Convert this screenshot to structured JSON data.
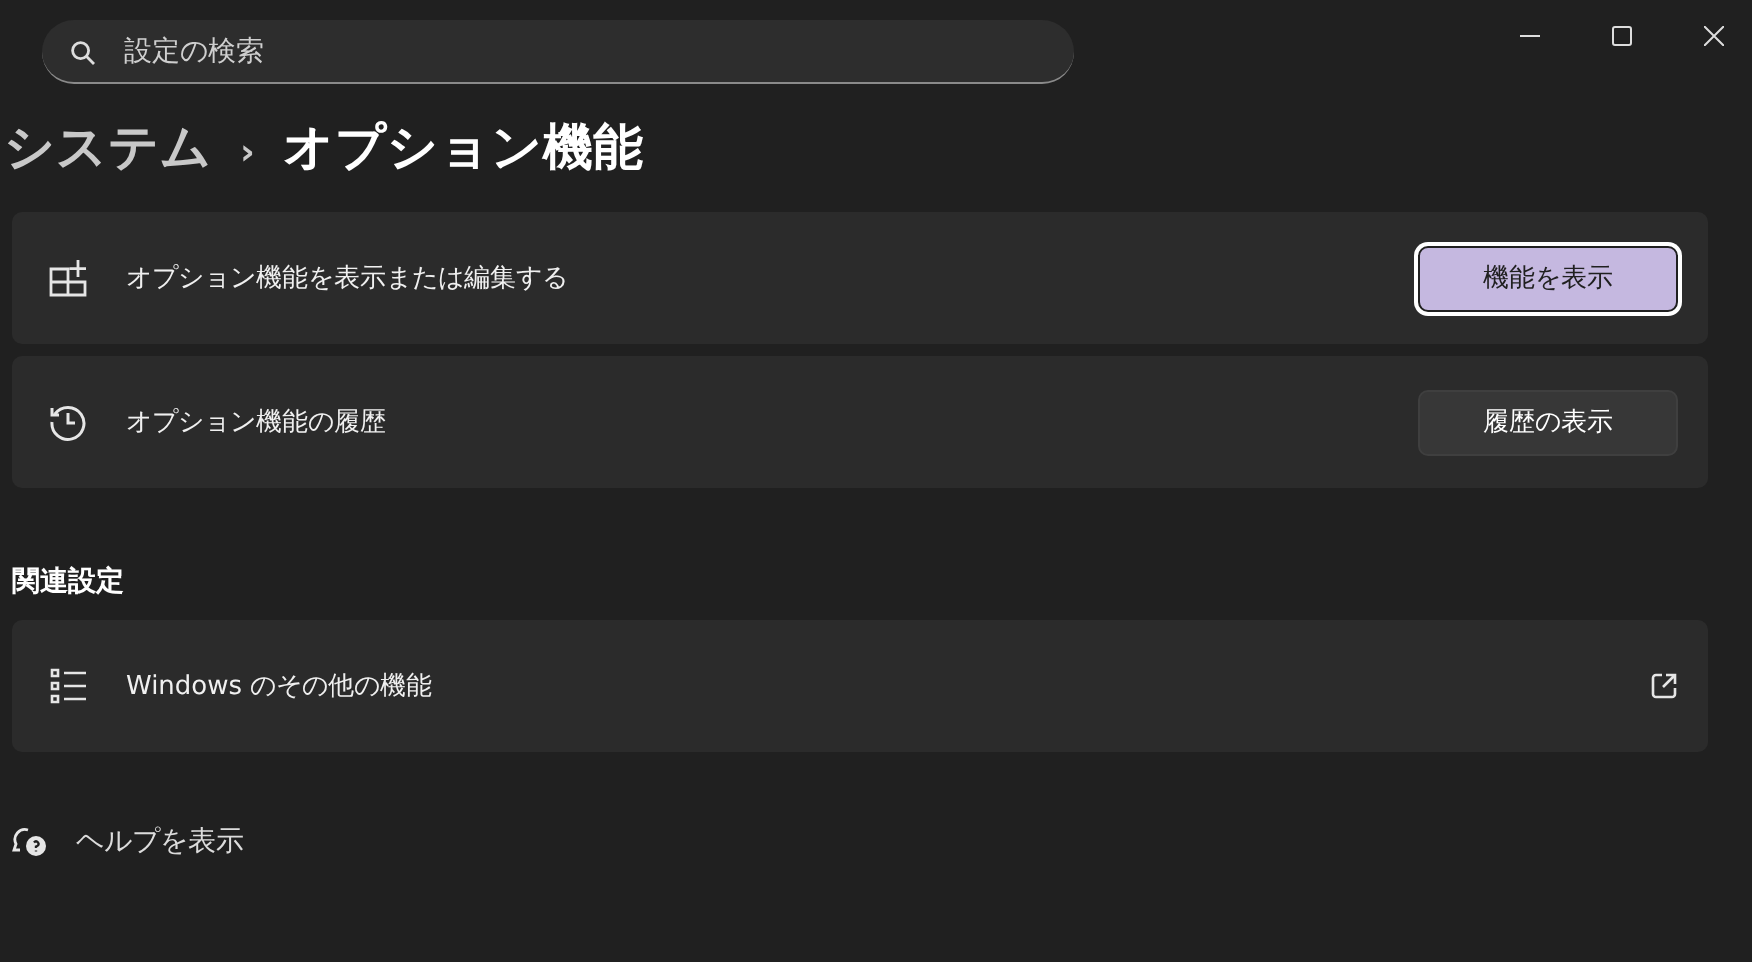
{
  "search": {
    "placeholder": "設定の検索"
  },
  "breadcrumb": {
    "parent": "システム",
    "separator": "›",
    "current": "オプション機能"
  },
  "cards": [
    {
      "label": "オプション機能を表示または編集する",
      "button": {
        "label": "機能を表示",
        "kind": "accent"
      }
    },
    {
      "label": "オプション機能の履歴",
      "button": {
        "label": "履歴の表示",
        "kind": "standard"
      }
    }
  ],
  "related": {
    "heading": "関連設定",
    "items": [
      {
        "label": "Windows のその他の機能"
      }
    ]
  },
  "help": {
    "label": "ヘルプを表示"
  }
}
